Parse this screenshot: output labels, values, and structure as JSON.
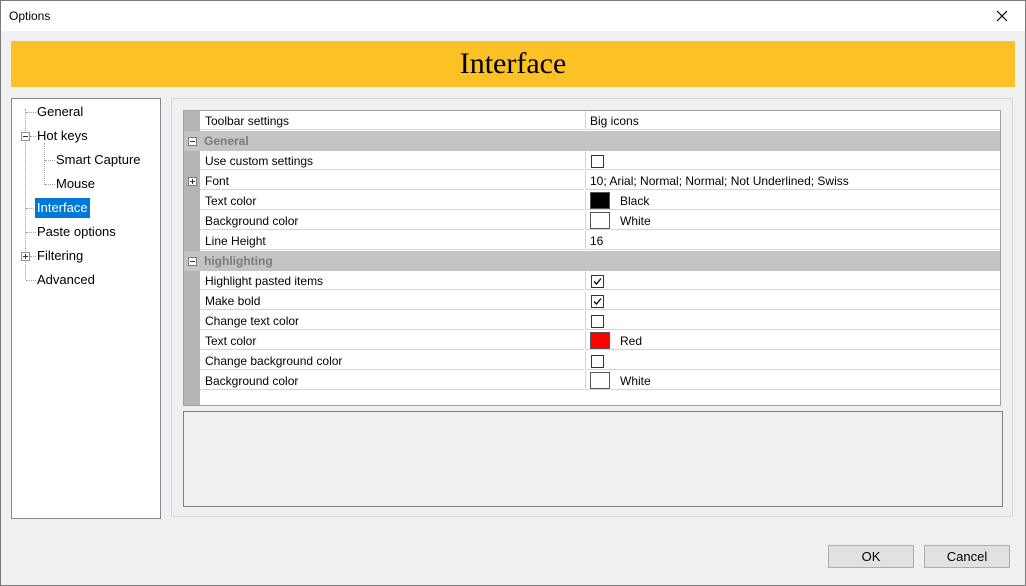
{
  "window": {
    "title": "Options",
    "close_icon": "close-icon"
  },
  "banner": {
    "title": "Interface",
    "color": "#fcc125"
  },
  "tree": {
    "items": [
      {
        "label": "General"
      },
      {
        "label": "Hot keys"
      },
      {
        "label": "Smart Capture"
      },
      {
        "label": "Mouse"
      },
      {
        "label": "Interface",
        "selected": true
      },
      {
        "label": "Paste options"
      },
      {
        "label": "Filtering"
      },
      {
        "label": "Advanced"
      }
    ]
  },
  "grid": {
    "toolbar": {
      "name": "Toolbar settings",
      "value": "Big icons"
    },
    "general": {
      "label": "General",
      "use_custom": {
        "name": "Use custom settings",
        "checked": false
      },
      "font": {
        "name": "Font",
        "value": "10; Arial; Normal; Normal; Not Underlined; Swiss"
      },
      "text_color": {
        "name": "Text color",
        "value": "Black",
        "color": "#000000"
      },
      "bg_color": {
        "name": "Background color",
        "value": "White",
        "color": "#ffffff"
      },
      "line_height": {
        "name": "Line Height",
        "value": "16"
      }
    },
    "highlighting": {
      "label": "highlighting",
      "highlight_pasted": {
        "name": "Highlight pasted items",
        "checked": true
      },
      "make_bold": {
        "name": "Make bold",
        "checked": true
      },
      "change_text_color": {
        "name": "Change text color",
        "checked": false
      },
      "text_color": {
        "name": "Text color",
        "value": "Red",
        "color": "#ff0000"
      },
      "change_bg_color": {
        "name": "Change background color",
        "checked": false
      },
      "bg_color": {
        "name": "Background color",
        "value": "White",
        "color": "#ffffff"
      }
    }
  },
  "buttons": {
    "ok": "OK",
    "cancel": "Cancel"
  }
}
